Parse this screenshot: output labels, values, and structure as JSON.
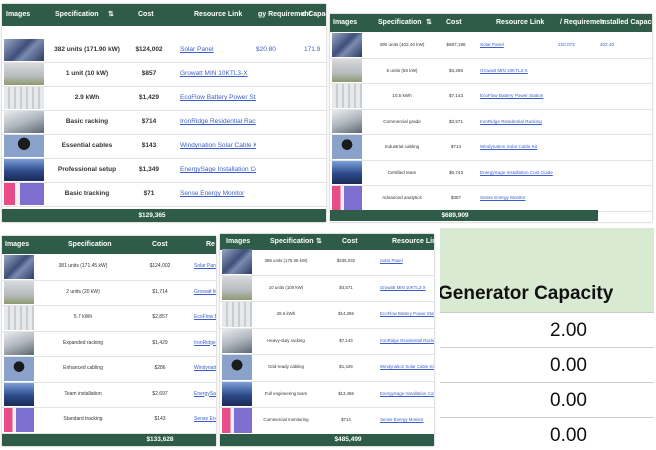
{
  "colors": {
    "header_bg": "#2f5c49",
    "header_text": "#ffffff",
    "link": "#3a5fcd",
    "gen_header_bg": "#d9ead3"
  },
  "panel1": {
    "headers": {
      "images": "Images",
      "spec": "Specification",
      "cost": "Cost",
      "link": "Resource Link",
      "energy": "gy Requirement",
      "capacity": "d Capaci"
    },
    "rows": [
      {
        "img": "solar-panel-image",
        "spec": "382 units (171.90 kW)",
        "cost": "$124,002",
        "link": "Solar Panel",
        "energy": "$20.80",
        "capacity": "171.9"
      },
      {
        "img": "inverter-image",
        "spec": "1 unit (10 kW)",
        "cost": "$857",
        "link": "Growatt MIN 10KTL3-X",
        "energy": "",
        "capacity": ""
      },
      {
        "img": "battery-image",
        "spec": "2.9 kWh",
        "cost": "$1,429",
        "link": "EcoFlow Battery Power Station",
        "energy": "",
        "capacity": ""
      },
      {
        "img": "racking-image",
        "spec": "Basic racking",
        "cost": "$714",
        "link": "IronRidge Residential Racking",
        "energy": "",
        "capacity": ""
      },
      {
        "img": "cables-image",
        "spec": "Essential cables",
        "cost": "$143",
        "link": "Windynation Solar Cable Kit",
        "energy": "",
        "capacity": ""
      },
      {
        "img": "setup-image",
        "spec": "Professional setup",
        "cost": "$1,349",
        "link": "EnergySage Installation Cost Guide",
        "energy": "",
        "capacity": ""
      },
      {
        "img": "tracker-image",
        "spec": "Basic tracking",
        "cost": "$71",
        "link": "Sense Energy Monitor",
        "energy": "",
        "capacity": ""
      }
    ],
    "total": "$129,365"
  },
  "panel2": {
    "headers": {
      "images": "Images",
      "spec": "Specification",
      "cost": "Cost",
      "link": "Resource Link",
      "energy": "/ Requiremen",
      "capacity": "Installed Capacity"
    },
    "rows": [
      {
        "img": "solar-panel-image",
        "spec": "390 units (402.40 kW)",
        "cost": "$687,196",
        "link": "Solar Panel",
        "energy": "220.073",
        "capacity": "402.40"
      },
      {
        "img": "inverter-image",
        "spec": "5 units (50 kW)",
        "cost": "$4,285",
        "link": "Growatt MIN 10KTL3-X",
        "energy": "",
        "capacity": ""
      },
      {
        "img": "battery-image",
        "spec": "10.5 kWh",
        "cost": "$7,143",
        "link": "EcoFlow Battery Power Station",
        "energy": "",
        "capacity": ""
      },
      {
        "img": "racking-image",
        "spec": "Commercial grade",
        "cost": "$3,571",
        "link": "IronRidge Residential Racking",
        "energy": "",
        "capacity": ""
      },
      {
        "img": "cables-image",
        "spec": "Industrial cabling",
        "cost": "$714",
        "link": "Windynation Solar Cable Kit",
        "energy": "",
        "capacity": ""
      },
      {
        "img": "setup-image",
        "spec": "Certified team",
        "cost": "$6,743",
        "link": "EnergySage Installation Cost Guide",
        "energy": "",
        "capacity": ""
      },
      {
        "img": "tracker-image",
        "spec": "Advanced analytics",
        "cost": "$357",
        "link": "Sense Energy Monitor",
        "energy": "",
        "capacity": ""
      }
    ],
    "total": "$689,909"
  },
  "panel3": {
    "headers": {
      "images": "Images",
      "spec": "Specification",
      "cost": "Cost",
      "link": "Re"
    },
    "rows": [
      {
        "img": "solar-panel-image",
        "spec": "381 units (171.45 kW)",
        "cost": "$124,002",
        "link": "Solar Panel"
      },
      {
        "img": "inverter-image",
        "spec": "2 units (20 kW)",
        "cost": "$1,714",
        "link": "Growatt MIN 10KTL3-X"
      },
      {
        "img": "battery-image",
        "spec": "5.7 kWh",
        "cost": "$2,857",
        "link": "EcoFlow Battery"
      },
      {
        "img": "racking-image",
        "spec": "Expanded racking",
        "cost": "$1,429",
        "link": "IronRidge Residential"
      },
      {
        "img": "cables-image",
        "spec": "Enhanced cabling",
        "cost": "$286",
        "link": "Windynation"
      },
      {
        "img": "setup-image",
        "spec": "Team installation",
        "cost": "$2,697",
        "link": "EnergySage Installation"
      },
      {
        "img": "tracker-image",
        "spec": "Standard tracking",
        "cost": "$143",
        "link": "Sense Energy"
      }
    ],
    "total": "$133,628"
  },
  "panel4": {
    "headers": {
      "images": "Images",
      "spec": "Specification",
      "cost": "Cost",
      "link": "Resource Link"
    },
    "rows": [
      {
        "img": "solar-panel-image",
        "spec": "389 units (175.05 kW)",
        "cost": "$435,032",
        "link": "Solar Panel"
      },
      {
        "img": "inverter-image",
        "spec": "10 units (100 kW)",
        "cost": "$4,571",
        "link": "Growatt MIN 10KTL3-X"
      },
      {
        "img": "battery-image",
        "spec": "28.6 kWh",
        "cost": "$14,286",
        "link": "EcoFlow Battery Power Station"
      },
      {
        "img": "racking-image",
        "spec": "Heavy-duty racking",
        "cost": "$7,143",
        "link": "IronRidge Residential Racking"
      },
      {
        "img": "cables-image",
        "spec": "Grid-ready cabling",
        "cost": "$1,429",
        "link": "Windynation Solar Cable Kit"
      },
      {
        "img": "setup-image",
        "spec": "Full engineering team",
        "cost": "$13,486",
        "link": "EnergySage Installation Cost"
      },
      {
        "img": "tracker-image",
        "spec": "Commercial monitoring",
        "cost": "$714",
        "link": "Sense Energy Monitor"
      }
    ],
    "total": "$485,499"
  },
  "generator": {
    "header": "Generator Capacity",
    "values": [
      "2.00",
      "0.00",
      "0.00",
      "0.00"
    ]
  }
}
